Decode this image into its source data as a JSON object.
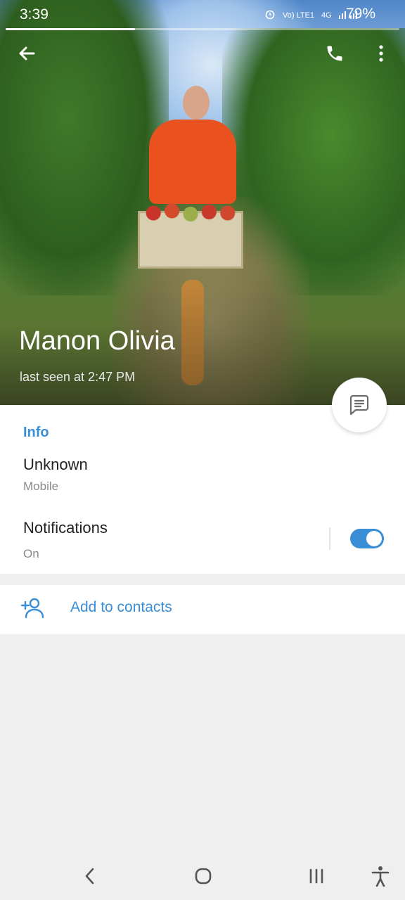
{
  "status_bar": {
    "time": "3:39",
    "network": "Vo) LTE1",
    "network_type": "4G",
    "battery": "79%"
  },
  "profile": {
    "name": "Manon Olivia",
    "last_seen": "last seen at 2:47 PM"
  },
  "info": {
    "section_title": "Info",
    "phone_value": "Unknown",
    "phone_label": "Mobile",
    "notifications_title": "Notifications",
    "notifications_state": "On",
    "notifications_enabled": true
  },
  "actions": {
    "add_to_contacts": "Add to contacts"
  },
  "colors": {
    "accent": "#3a8ed6",
    "background": "#efefef",
    "card": "#ffffff"
  },
  "icons": {
    "back": "arrow-left-icon",
    "call": "phone-icon",
    "more": "more-vertical-icon",
    "message": "chat-bubble-icon",
    "add_contact": "add-person-icon",
    "nav_back": "chevron-left-icon",
    "nav_home": "home-icon",
    "nav_recents": "recents-icon",
    "accessibility": "accessibility-icon"
  }
}
